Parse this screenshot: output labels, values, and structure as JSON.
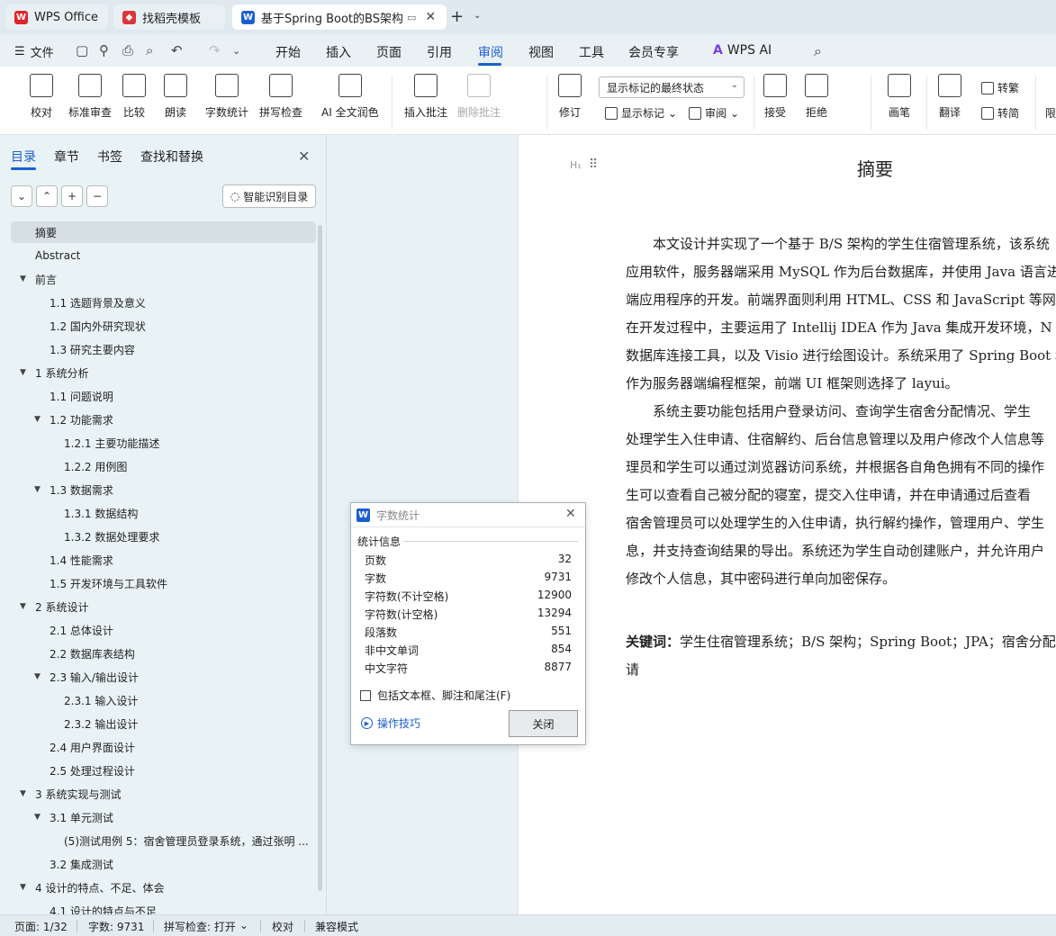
{
  "tabs": [
    {
      "label": "WPS Office",
      "icon": "wps-logo-icon",
      "color": "#e0262b"
    },
    {
      "label": "找稻壳模板",
      "icon": "docer-logo-icon",
      "color": "#d9363e"
    },
    {
      "label": "基于Spring Boot的BS架构学",
      "icon": "word-doc-icon",
      "color": "#1b5fcf"
    }
  ],
  "menubar": {
    "file_label": "文件",
    "items": [
      "开始",
      "插入",
      "页面",
      "引用",
      "审阅",
      "视图",
      "工具",
      "会员专享",
      "WPS AI"
    ],
    "active": "审阅"
  },
  "ribbon": {
    "buttons": [
      {
        "label": "校对",
        "icon": "proofread-icon"
      },
      {
        "label": "标准审查",
        "icon": "standard-review-icon"
      },
      {
        "label": "比较",
        "icon": "compare-icon"
      },
      {
        "label": "朗读",
        "icon": "read-aloud-icon"
      },
      {
        "label": "字数统计",
        "icon": "word-count-icon"
      },
      {
        "label": "拼写检查",
        "icon": "spell-check-icon"
      },
      {
        "label": "AI 全文润色",
        "icon": "ai-polish-icon"
      },
      {
        "label": "插入批注",
        "icon": "insert-comment-icon"
      },
      {
        "label": "删除批注",
        "icon": "delete-comment-icon"
      },
      {
        "label": "修订",
        "icon": "track-changes-icon"
      },
      {
        "label": "接受",
        "icon": "accept-icon"
      },
      {
        "label": "拒绝",
        "icon": "reject-icon"
      },
      {
        "label": "画笔",
        "icon": "pen-icon"
      },
      {
        "label": "翻译",
        "icon": "translate-icon"
      }
    ],
    "track_mode": "显示标记的最终状态",
    "show_markup": "显示标记",
    "review_pane": "审阅",
    "to_traditional": "转繁",
    "to_simplified": "转简",
    "limit": "限"
  },
  "nav": {
    "tabs": [
      "目录",
      "章节",
      "书签",
      "查找和替换"
    ],
    "active_tab": "目录",
    "smart_label": "智能识别目录",
    "toc": [
      {
        "text": "摘要",
        "level": 0,
        "arrow": "",
        "selected": true
      },
      {
        "text": "Abstract",
        "level": 0,
        "arrow": ""
      },
      {
        "text": "前言",
        "level": 0,
        "arrow": "▼"
      },
      {
        "text": "1.1 选题背景及意义",
        "level": 1,
        "arrow": ""
      },
      {
        "text": "1.2 国内外研究现状",
        "level": 1,
        "arrow": ""
      },
      {
        "text": "1.3 研究主要内容",
        "level": 1,
        "arrow": ""
      },
      {
        "text": "1 系统分析",
        "level": 0,
        "arrow": "▼"
      },
      {
        "text": "1.1 问题说明",
        "level": 1,
        "arrow": ""
      },
      {
        "text": "1.2 功能需求",
        "level": 1,
        "arrow": "▼"
      },
      {
        "text": "1.2.1 主要功能描述",
        "level": 2,
        "arrow": ""
      },
      {
        "text": "1.2.2 用例图",
        "level": 2,
        "arrow": ""
      },
      {
        "text": "1.3 数据需求",
        "level": 1,
        "arrow": "▼"
      },
      {
        "text": "1.3.1 数据结构",
        "level": 2,
        "arrow": ""
      },
      {
        "text": "1.3.2 数据处理要求",
        "level": 2,
        "arrow": ""
      },
      {
        "text": "1.4 性能需求",
        "level": 1,
        "arrow": ""
      },
      {
        "text": "1.5 开发环境与工具软件",
        "level": 1,
        "arrow": ""
      },
      {
        "text": "2 系统设计",
        "level": 0,
        "arrow": "▼"
      },
      {
        "text": "2.1 总体设计",
        "level": 1,
        "arrow": ""
      },
      {
        "text": "2.2 数据库表结构",
        "level": 1,
        "arrow": ""
      },
      {
        "text": "2.3 输入/输出设计",
        "level": 1,
        "arrow": "▼"
      },
      {
        "text": "2.3.1 输入设计",
        "level": 2,
        "arrow": ""
      },
      {
        "text": "2.3.2 输出设计",
        "level": 2,
        "arrow": ""
      },
      {
        "text": "2.4 用户界面设计",
        "level": 1,
        "arrow": ""
      },
      {
        "text": "2.5 处理过程设计",
        "level": 1,
        "arrow": ""
      },
      {
        "text": "3 系统实现与测试",
        "level": 0,
        "arrow": "▼"
      },
      {
        "text": "3.1 单元测试",
        "level": 1,
        "arrow": "▼"
      },
      {
        "text": "(5)测试用例 5：宿舍管理员登录系统，通过张明 ...",
        "level": 2,
        "arrow": ""
      },
      {
        "text": "3.2 集成测试",
        "level": 1,
        "arrow": ""
      },
      {
        "text": "4 设计的特点、不足、体会",
        "level": 0,
        "arrow": "▼"
      },
      {
        "text": "4.1 设计的特点与不足",
        "level": 1,
        "arrow": ""
      }
    ]
  },
  "document": {
    "title": "摘要",
    "lines": [
      "　　本文设计并实现了一个基于 B/S 架构的学生住宿管理系统，该系统",
      "应用软件，服务器端采用 MySQL 作为后台数据库，并使用 Java 语言进",
      "端应用程序的开发。前端界面则利用 HTML、CSS 和 JavaScript 等网页",
      "在开发过程中，主要运用了 Intellij IDEA 作为 Java 集成开发环境，N",
      "数据库连接工具，以及 Visio 进行绘图设计。系统采用了 Spring Boot 和",
      "作为服务器端编程框架，前端 UI 框架则选择了 layui。",
      "　　系统主要功能包括用户登录访问、查询学生宿舍分配情况、学生",
      "处理学生入住申请、住宿解约、后台信息管理以及用户修改个人信息等",
      "理员和学生可以通过浏览器访问系统，并根据各自角色拥有不同的操作",
      "生可以查看自己被分配的寝室，提交入住申请，并在申请通过后查看",
      "宿舍管理员可以处理学生的入住申请，执行解约操作，管理用户、学生",
      "息，并支持查询结果的导出。系统还为学生自动创建账户，并允许用户",
      "修改个人信息，其中密码进行单向加密保存。"
    ],
    "keywords_label": "关键词：",
    "keywords_line1": "学生住宿管理系统；B/S 架构；Spring Boot；JPA；宿舍分配",
    "keywords_line2": "请"
  },
  "dialog": {
    "title": "字数统计",
    "section": "统计信息",
    "stats": [
      {
        "label": "页数",
        "value": "32"
      },
      {
        "label": "字数",
        "value": "9731"
      },
      {
        "label": "字符数(不计空格)",
        "value": "12900"
      },
      {
        "label": "字符数(计空格)",
        "value": "13294"
      },
      {
        "label": "段落数",
        "value": "551"
      },
      {
        "label": "非中文单词",
        "value": "854"
      },
      {
        "label": "中文字符",
        "value": "8877"
      }
    ],
    "checkbox_label": "包括文本框、脚注和尾注(F)",
    "tips_label": "操作技巧",
    "close_label": "关闭"
  },
  "statusbar": {
    "page": "页面: 1/32",
    "words": "字数: 9731",
    "spell": "拼写检查: 打开",
    "proof": "校对",
    "compat": "兼容模式"
  }
}
